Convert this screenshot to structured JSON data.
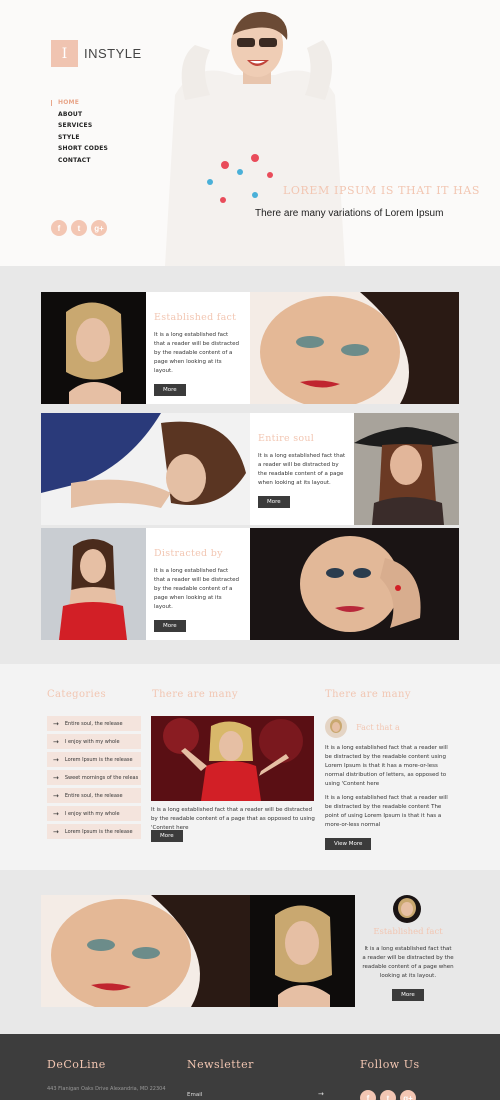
{
  "brand": {
    "logo_letter": "I",
    "name": "INSTYLE"
  },
  "nav": [
    "HOME",
    "ABOUT",
    "SERVICES",
    "STYLE",
    "SHORT CODES",
    "CONTACT"
  ],
  "hero": {
    "tagline": "LOREM IPSUM IS THAT IT HAS",
    "subtitle": "There are many variations of Lorem Ipsum",
    "social": [
      "f",
      "t",
      "g+"
    ]
  },
  "gallery": {
    "tiles": [
      {
        "title": "Established fact",
        "text": "It is a long established fact that a reader will be distracted by the readable content of a page when looking at its layout.",
        "button": "More"
      },
      {
        "title": "Entire soul",
        "text": "It is a long established fact that a reader will be distracted by the readable content of a page when looking at its layout.",
        "button": "More"
      },
      {
        "title": "Distracted by",
        "text": "It is a long established fact that a reader will be distracted by the readable content of a page when looking at its layout.",
        "button": "More"
      }
    ]
  },
  "categories": {
    "heading": "Categories",
    "items": [
      "Entire soul, the release",
      "I enjoy with my whole",
      "Lorem Ipsum is the release",
      "Sweet mornings of the releas",
      "Entire soul, the release",
      "I enjoy with my whole",
      "Lorem Ipsum is the release"
    ]
  },
  "middle": {
    "heading": "There are many",
    "text": "It is a long established fact that a reader will be distracted by the readable content of a page that as opposed to using 'Content here",
    "button": "More"
  },
  "right": {
    "heading": "There are many",
    "item_title": "Fact that a",
    "para1": "It is a long established fact that a reader will be distracted by the readable content using Lorem Ipsum is that it has a more-or-less normal distribution of letters, as opposed to using 'Content here",
    "para2": "It is a long established fact that a reader will be distracted by the readable content The point of using Lorem Ipsum is that it has a more-or-less normal",
    "button": "View More"
  },
  "band3": {
    "title": "Established fact",
    "text": "It is a long established fact that a reader will be distracted by the readable content of a page when looking at its layout.",
    "button": "More"
  },
  "footer": {
    "col1_heading": "DeCoLine",
    "address": "443 Flanigan Oaks Drive Alexandria, MD 22304",
    "col2_heading": "Newsletter",
    "email_label": "Email",
    "col3_heading": "Follow Us",
    "social": [
      "f",
      "t",
      "g+"
    ]
  },
  "colors": {
    "accent": "#f2c6b2",
    "dark": "#3d3d3d",
    "band": "#e8e8e8"
  }
}
